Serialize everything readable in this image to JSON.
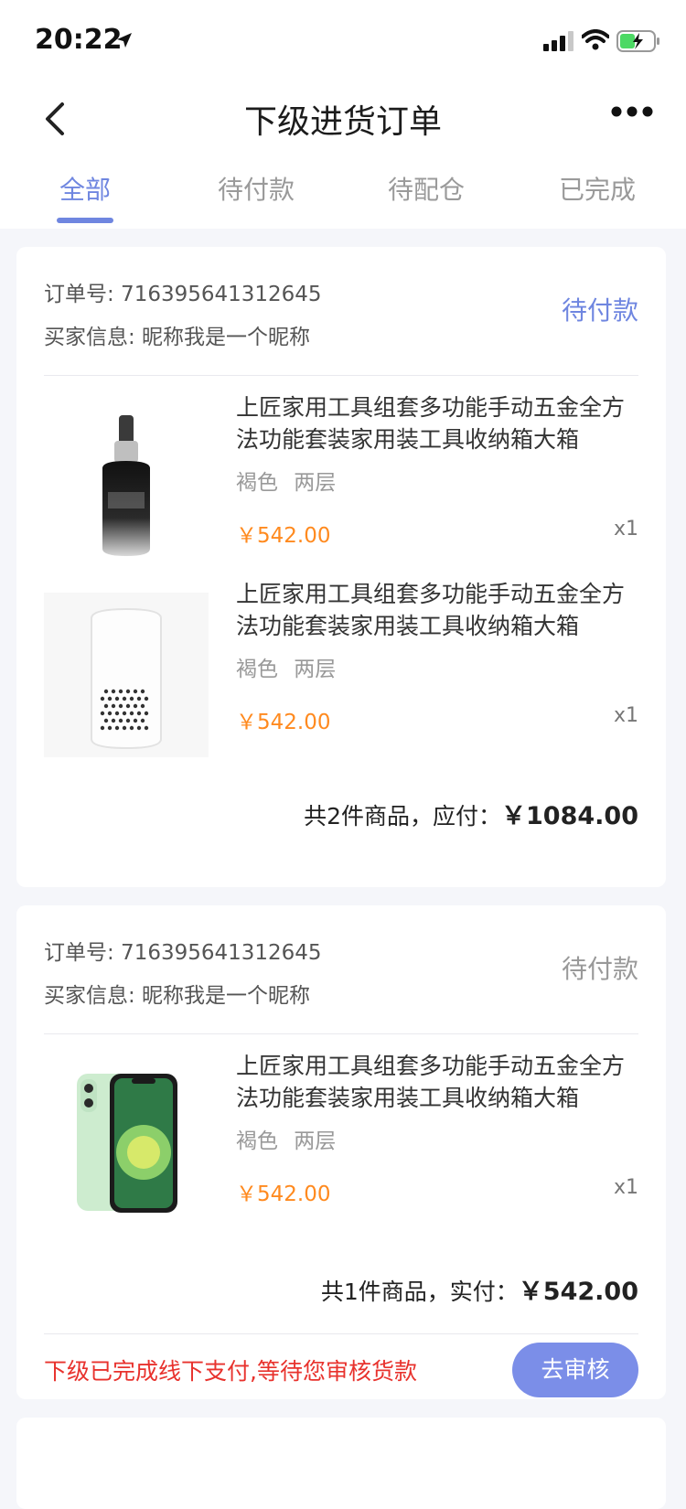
{
  "status_bar": {
    "time": "20:22"
  },
  "nav": {
    "title": "下级进货订单"
  },
  "tabs": [
    {
      "label": "全部",
      "active": true
    },
    {
      "label": "待付款",
      "active": false
    },
    {
      "label": "待配仓",
      "active": false
    },
    {
      "label": "已完成",
      "active": false
    }
  ],
  "orders": [
    {
      "order_no": "订单号: 716395641312645",
      "buyer": "买家信息: 昵称我是一个昵称",
      "status": "待付款",
      "status_color": "#6f86e0",
      "items": [
        {
          "image": "serum-bottle-icon",
          "name": "上匠家用工具组套多功能手动五金全方法功能套装家用装工具收纳箱大箱",
          "spec": "褐色 两层",
          "price": "￥542.00",
          "qty": "x1"
        },
        {
          "image": "speaker-icon",
          "name": "上匠家用工具组套多功能手动五金全方法功能套装家用装工具收纳箱大箱",
          "spec": "褐色 两层",
          "price": "￥542.00",
          "qty": "x1"
        }
      ],
      "summary_prefix": "共2件商品，应付：",
      "summary_amount": "￥1084.00"
    },
    {
      "order_no": "订单号: 716395641312645",
      "buyer": "买家信息: 昵称我是一个昵称",
      "status": "待付款",
      "status_color": "#999999",
      "items": [
        {
          "image": "phone-icon",
          "name": "上匠家用工具组套多功能手动五金全方法功能套装家用装工具收纳箱大箱",
          "spec": "褐色 两层",
          "price": "￥542.00",
          "qty": "x1"
        }
      ],
      "summary_prefix": "共1件商品，实付：",
      "summary_amount": "￥542.00",
      "notice": "下级已完成线下支付,等待您审核货款",
      "action_label": "去审核"
    }
  ]
}
